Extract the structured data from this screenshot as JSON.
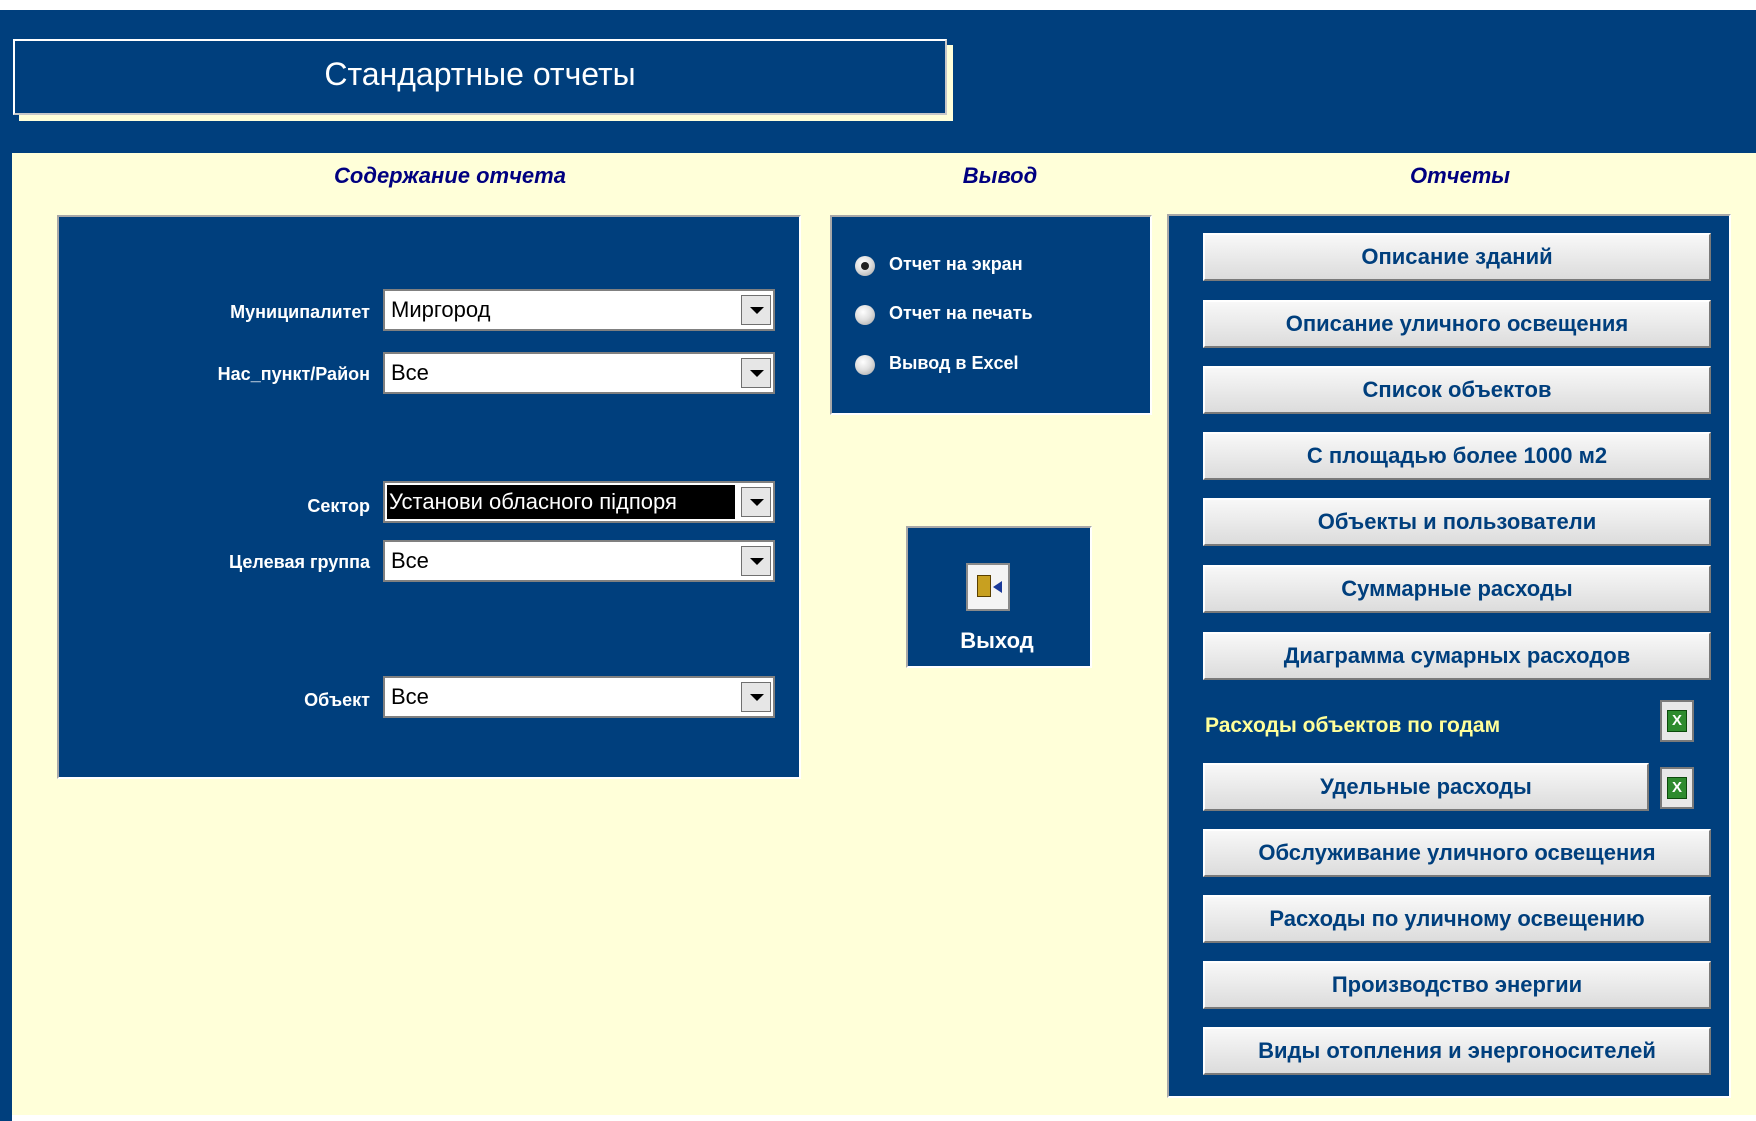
{
  "window": {
    "title": "Стандартные отчеты"
  },
  "sections": {
    "content_title": "Содержание отчета",
    "output_title": "Вывод",
    "reports_title": "Отчеты"
  },
  "filters": {
    "municipality": {
      "label": "Муниципалитет",
      "value": "Миргород"
    },
    "locality": {
      "label": "Нас_пункт/Район",
      "value": "Все"
    },
    "sector": {
      "label": "Сектор",
      "value": "Установи обласного підпоря"
    },
    "target_group": {
      "label": "Целевая группа",
      "value": "Все"
    },
    "object": {
      "label": "Объект",
      "value": "Все"
    }
  },
  "output": {
    "options": [
      {
        "label": "Отчет на экран",
        "selected": true
      },
      {
        "label": "Отчет на печать",
        "selected": false
      },
      {
        "label": "Вывод в Excel",
        "selected": false
      }
    ],
    "exit_label": "Выход",
    "exit_icon": "exit-door-icon"
  },
  "reports": {
    "describe_buildings": "Описание зданий",
    "describe_street_lighting": "Описание уличного освещения",
    "object_list": "Список объектов",
    "area_over_1000": "С площадью более 1000 м2",
    "objects_and_users": "Объекты и пользователи",
    "total_expenses": "Суммарные расходы",
    "total_expenses_chart": "Диаграмма сумарных расходов",
    "expenses_by_year": "Расходы объектов по годам",
    "specific_expenses": "Удельные расходы",
    "street_lighting_service": "Обслуживание уличного освещения",
    "street_lighting_expenses": "Расходы по уличному освещению",
    "energy_production": "Производство энергии",
    "heating_types": "Виды отопления и энергоносителей",
    "excel_icon_glyph": "X"
  },
  "colors": {
    "frame_blue": "#003f7d",
    "background": "#ffffd9",
    "header_text": "#000080",
    "button_text": "#003f7d",
    "yellow_label": "#ffff99"
  }
}
